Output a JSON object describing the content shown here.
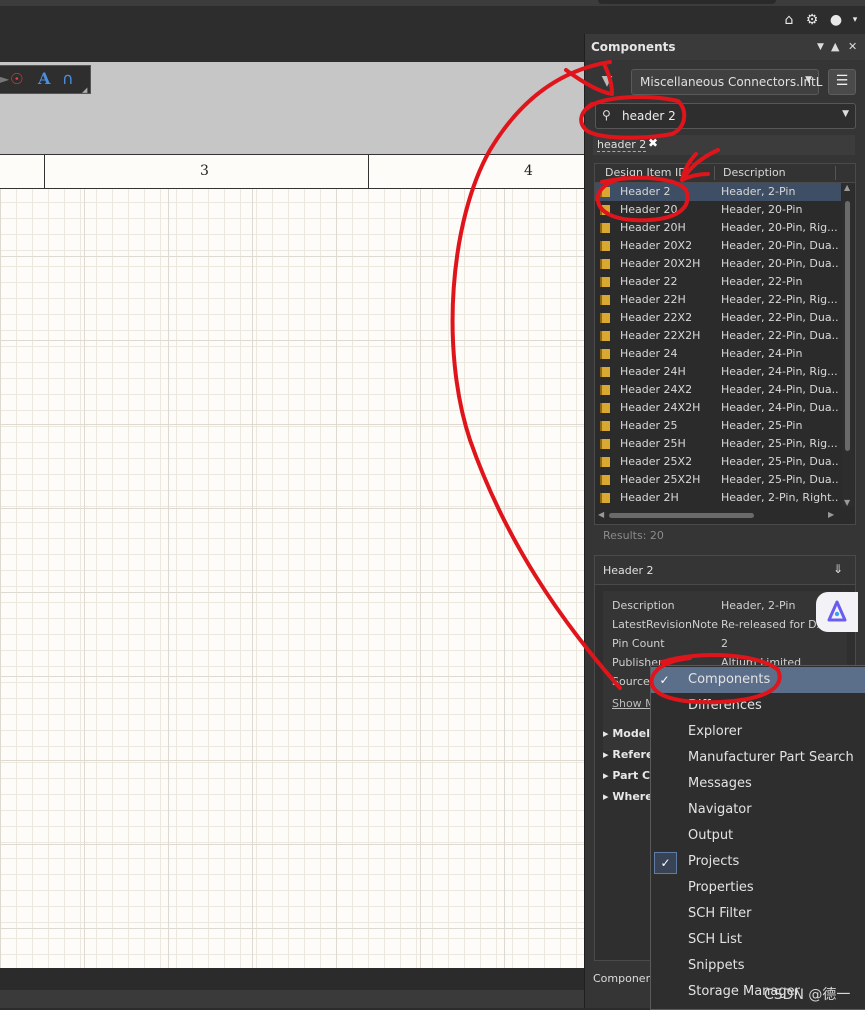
{
  "panel": {
    "title": "Components",
    "library": "Miscellaneous Connectors.IntL",
    "search_value": "header 2",
    "chip": "header 2",
    "columns": [
      "Design Item ID",
      "Description"
    ],
    "rows": [
      {
        "id": "Header 2",
        "desc": "Header, 2-Pin"
      },
      {
        "id": "Header 20",
        "desc": "Header, 20-Pin"
      },
      {
        "id": "Header 20H",
        "desc": "Header, 20-Pin, Rig..."
      },
      {
        "id": "Header 20X2",
        "desc": "Header, 20-Pin, Dua..."
      },
      {
        "id": "Header 20X2H",
        "desc": "Header, 20-Pin, Dua..."
      },
      {
        "id": "Header 22",
        "desc": "Header, 22-Pin"
      },
      {
        "id": "Header 22H",
        "desc": "Header, 22-Pin, Rig..."
      },
      {
        "id": "Header 22X2",
        "desc": "Header, 22-Pin, Dua..."
      },
      {
        "id": "Header 22X2H",
        "desc": "Header, 22-Pin, Dua..."
      },
      {
        "id": "Header 24",
        "desc": "Header, 24-Pin"
      },
      {
        "id": "Header 24H",
        "desc": "Header, 24-Pin, Rig..."
      },
      {
        "id": "Header 24X2",
        "desc": "Header, 24-Pin, Dua..."
      },
      {
        "id": "Header 24X2H",
        "desc": "Header, 24-Pin, Dua..."
      },
      {
        "id": "Header 25",
        "desc": "Header, 25-Pin"
      },
      {
        "id": "Header 25H",
        "desc": "Header, 25-Pin, Rig..."
      },
      {
        "id": "Header 25X2",
        "desc": "Header, 25-Pin, Dua..."
      },
      {
        "id": "Header 25X2H",
        "desc": "Header, 25-Pin, Dua..."
      },
      {
        "id": "Header 2H",
        "desc": "Header, 2-Pin, Right..."
      }
    ],
    "results": "Results: 20",
    "details_title": "Header 2",
    "props": {
      "description_label": "Description",
      "description_value": "Header, 2-Pin",
      "revision_label": "LatestRevisionNote",
      "revision_value": "Re-released for DX...",
      "pincount_label": "Pin Count",
      "pincount_value": "2",
      "publisher_label": "Publisher",
      "publisher_value": "Altium Limited",
      "source_label": "Source",
      "show_more": "Show More"
    },
    "sections": [
      "Models",
      "References",
      "Part Choices",
      "Where Used"
    ],
    "footer_tab": "Components"
  },
  "sheet": {
    "zone_labels": [
      "3",
      "4"
    ]
  },
  "menu": {
    "items": [
      {
        "label": "Components",
        "checked": true,
        "active": true
      },
      {
        "label": "Differences",
        "checked": false
      },
      {
        "label": "Explorer",
        "checked": false
      },
      {
        "label": "Manufacturer Part Search",
        "checked": false
      },
      {
        "label": "Messages",
        "checked": false
      },
      {
        "label": "Navigator",
        "checked": false
      },
      {
        "label": "Output",
        "checked": false
      },
      {
        "label": "Projects",
        "checked": true,
        "boxed": true
      },
      {
        "label": "Properties",
        "checked": false
      },
      {
        "label": "SCH Filter",
        "checked": false
      },
      {
        "label": "SCH List",
        "checked": false
      },
      {
        "label": "Snippets",
        "checked": false
      },
      {
        "label": "Storage Manager",
        "checked": false
      }
    ]
  },
  "watermark": "CSDN @德一",
  "colors": {
    "annotation": "#e0151b",
    "selection": "#3e4e64",
    "menu_active": "#5b6e8a",
    "part_icon": "#d9a830"
  },
  "icons": [
    "home-icon",
    "gear-icon",
    "user-icon",
    "filter-icon",
    "search-icon",
    "hamburger-icon",
    "pin-icon",
    "close-icon"
  ]
}
